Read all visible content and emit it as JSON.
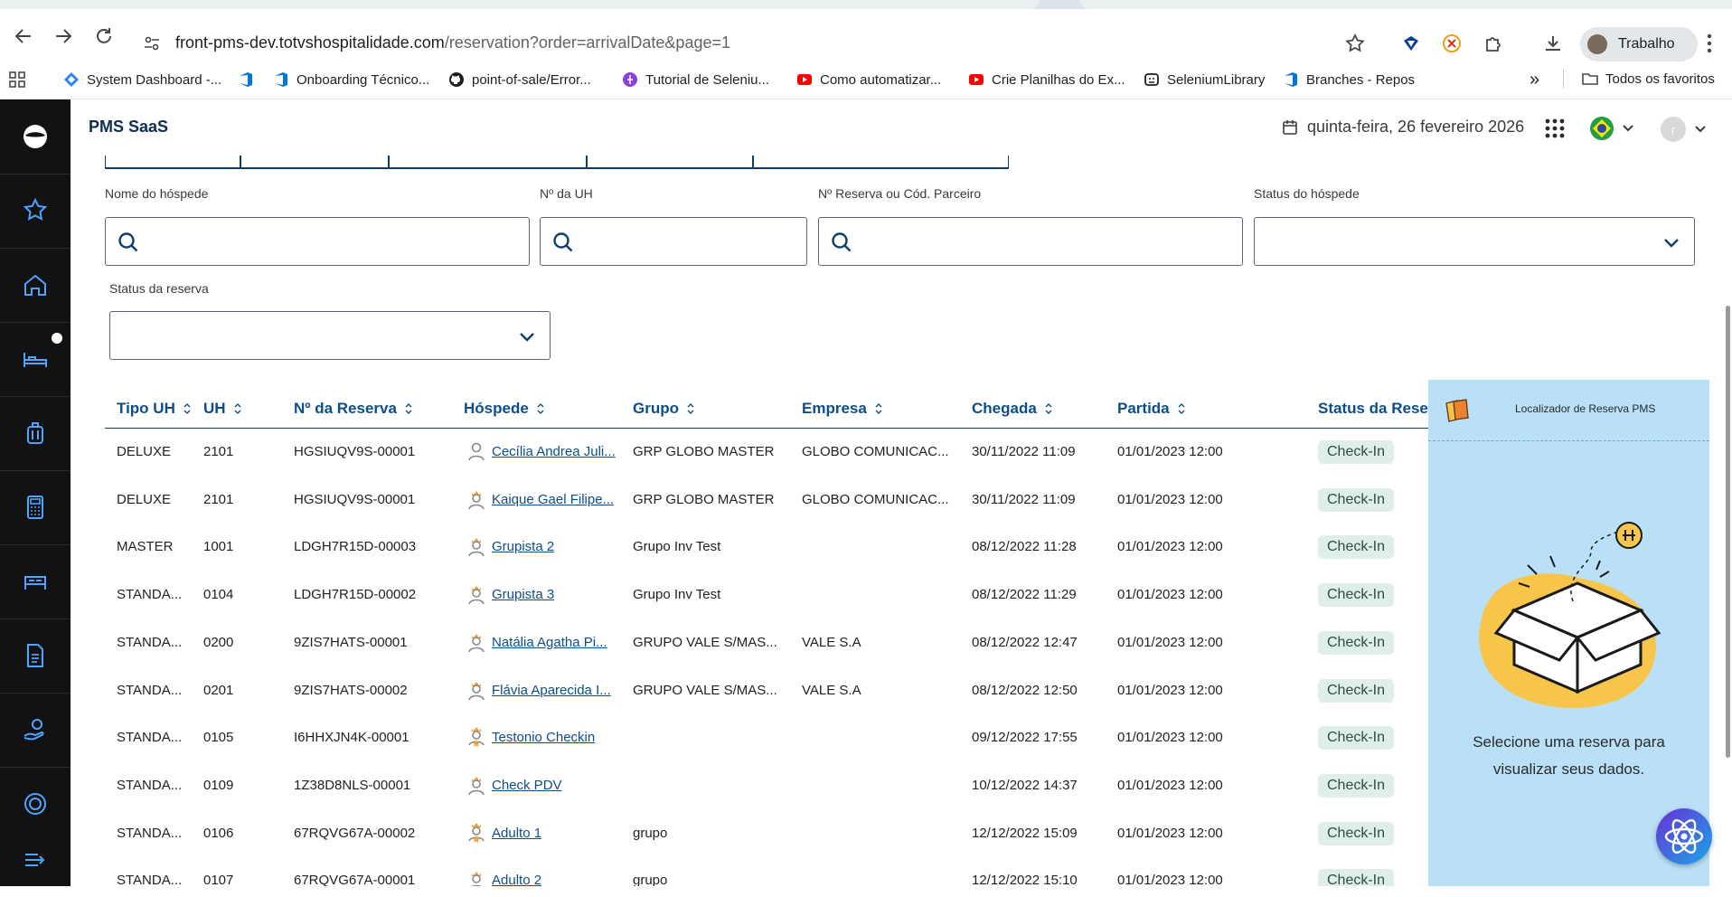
{
  "browser": {
    "url_host": "front-pms-dev.totvshospitalidade.com",
    "url_path": "/reservation?order=arrivalDate&page=1",
    "profile_label": "Trabalho",
    "bookmarks": [
      {
        "label": "System Dashboard -...",
        "icon": "jira-diamond-icon",
        "color": "#2684ff"
      },
      {
        "label": "",
        "icon": "azure-devops-icon",
        "color": "#0078d4"
      },
      {
        "label": "Onboarding Técnico...",
        "icon": "azure-devops-icon",
        "color": "#0078d4"
      },
      {
        "label": "point-of-sale/Error...",
        "icon": "github-icon",
        "color": "#1f1f1f"
      },
      {
        "label": "Tutorial de Seleniu...",
        "icon": "purple-circle-icon",
        "color": "#8e3fd6"
      },
      {
        "label": "Como automatizar...",
        "icon": "youtube-icon",
        "color": "#ff0000"
      },
      {
        "label": "Crie Planilhas do Ex...",
        "icon": "youtube-icon",
        "color": "#ff0000"
      },
      {
        "label": "SeleniumLibrary",
        "icon": "robot-icon",
        "color": "#1f1f1f"
      },
      {
        "label": "Branches - Repos",
        "icon": "azure-devops-icon",
        "color": "#0078d4"
      }
    ],
    "bookmarks_overflow": "»",
    "all_bookmarks_label": "Todos os favoritos"
  },
  "app": {
    "title": "PMS SaaS",
    "date": "quinta-feira, 26 fevereiro 2026"
  },
  "filters": {
    "guest_name_label": "Nome do hóspede",
    "unit_number_label": "Nº da UH",
    "reservation_label": "Nº Reserva ou Cód. Parceiro",
    "guest_status_label": "Status do hóspede",
    "reservation_status_label": "Status da reserva"
  },
  "table": {
    "headers": {
      "tipo_uh": "Tipo UH",
      "uh": "UH",
      "reserva": "Nº da Reserva",
      "hospede": "Hóspede",
      "grupo": "Grupo",
      "empresa": "Empresa",
      "chegada": "Chegada",
      "partida": "Partida",
      "status": "Status da Rese"
    },
    "rows": [
      {
        "tipo": "DELUXE",
        "uh": "2101",
        "reserva": "HGSIUQV9S-00001",
        "hospede": "Cecília Andrea Juli...",
        "grupo": "GRP GLOBO MASTER",
        "empresa": "GLOBO COMUNICAC...",
        "chegada": "30/11/2022 11:09",
        "partida": "01/01/2023 12:00",
        "status": "Check-In",
        "icon": "guest-plain"
      },
      {
        "tipo": "DELUXE",
        "uh": "2101",
        "reserva": "HGSIUQV9S-00001",
        "hospede": "Kaique Gael Filipe...",
        "grupo": "GRP GLOBO MASTER",
        "empresa": "GLOBO COMUNICAC...",
        "chegada": "30/11/2022 11:09",
        "partida": "01/01/2023 12:00",
        "status": "Check-In",
        "icon": "guest-crown"
      },
      {
        "tipo": "MASTER",
        "uh": "1001",
        "reserva": "LDGH7R15D-00003",
        "hospede": "Grupista 2",
        "grupo": "Grupo Inv Test",
        "empresa": "",
        "chegada": "08/12/2022 11:28",
        "partida": "01/01/2023 12:00",
        "status": "Check-In",
        "icon": "guest-crown"
      },
      {
        "tipo": "STANDA...",
        "uh": "0104",
        "reserva": "LDGH7R15D-00002",
        "hospede": "Grupista 3",
        "grupo": "Grupo Inv Test",
        "empresa": "",
        "chegada": "08/12/2022 11:29",
        "partida": "01/01/2023 12:00",
        "status": "Check-In",
        "icon": "guest-crown"
      },
      {
        "tipo": "STANDA...",
        "uh": "0200",
        "reserva": "9ZIS7HATS-00001",
        "hospede": "Natália Agatha Pi...",
        "grupo": "GRUPO VALE S/MAS...",
        "empresa": "VALE S.A",
        "chegada": "08/12/2022 12:47",
        "partida": "01/01/2023 12:00",
        "status": "Check-In",
        "icon": "guest-crown"
      },
      {
        "tipo": "STANDA...",
        "uh": "0201",
        "reserva": "9ZIS7HATS-00002",
        "hospede": "Flávia Aparecida I...",
        "grupo": "GRUPO VALE S/MAS...",
        "empresa": "VALE S.A",
        "chegada": "08/12/2022 12:50",
        "partida": "01/01/2023 12:00",
        "status": "Check-In",
        "icon": "guest-crown"
      },
      {
        "tipo": "STANDA...",
        "uh": "0105",
        "reserva": "I6HHXJN4K-00001",
        "hospede": "Testonio Checkin",
        "grupo": "",
        "empresa": "",
        "chegada": "09/12/2022 17:55",
        "partida": "01/01/2023 12:00",
        "status": "Check-In",
        "icon": "guest-crown-star"
      },
      {
        "tipo": "STANDA...",
        "uh": "0109",
        "reserva": "1Z38D8NLS-00001",
        "hospede": "Check PDV",
        "grupo": "",
        "empresa": "",
        "chegada": "10/12/2022 14:37",
        "partida": "01/01/2023 12:00",
        "status": "Check-In",
        "icon": "guest-crown"
      },
      {
        "tipo": "STANDA...",
        "uh": "0106",
        "reserva": "67RQVG67A-00002",
        "hospede": "Adulto 1",
        "grupo": "grupo",
        "empresa": "",
        "chegada": "12/12/2022 15:09",
        "partida": "01/01/2023 12:00",
        "status": "Check-In",
        "icon": "guest-crown-star"
      },
      {
        "tipo": "STANDA...",
        "uh": "0107",
        "reserva": "67RQVG67A-00001",
        "hospede": "Adulto 2",
        "grupo": "grupo",
        "empresa": "",
        "chegada": "12/12/2022 15:10",
        "partida": "01/01/2023 12:00",
        "status": "Check-In",
        "icon": "guest-crown"
      }
    ]
  },
  "panel": {
    "title": "Localizador de Reserva PMS",
    "message": "Selecione uma reserva para visualizar seus dados."
  },
  "colors": {
    "primary": "#0d4e8a",
    "rail": "#121212",
    "panel": "#b9e0f7",
    "badge": "#dfeee9",
    "accent_yellow": "#f7c54a"
  }
}
